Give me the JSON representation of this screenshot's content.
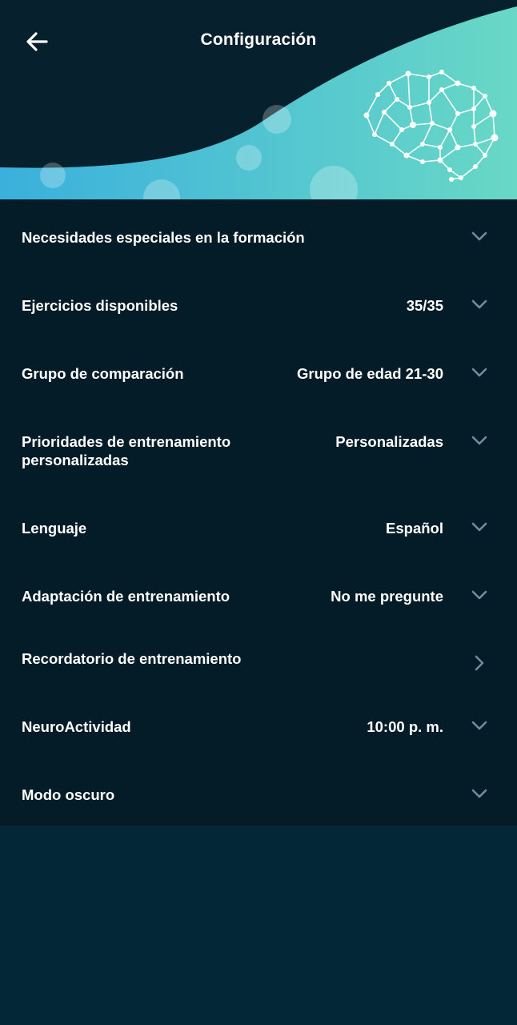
{
  "header": {
    "title": "Configuración",
    "back_icon": "arrow-left-icon",
    "illustration_icon": "brain-network-icon",
    "colors": {
      "background": "#06202d",
      "wave_start": "#3fb6d9",
      "wave_end": "#67d6c7"
    }
  },
  "settings": [
    {
      "label": "Necesidades especiales en la formación",
      "value": "",
      "icon": "chevron-down-icon"
    },
    {
      "label": "Ejercicios disponibles",
      "value": "35/35",
      "icon": "chevron-down-icon"
    },
    {
      "label": "Grupo de comparación",
      "value": "Grupo de edad 21-30",
      "icon": "chevron-down-icon"
    },
    {
      "label": "Prioridades de entrenamiento personalizadas",
      "value": "Personalizadas",
      "icon": "chevron-down-icon"
    },
    {
      "label": "Lenguaje",
      "value": "Español",
      "icon": "chevron-down-icon"
    },
    {
      "label": "Adaptación de entrenamiento",
      "value": "No me pregunte",
      "icon": "chevron-down-icon"
    },
    {
      "label": "Recordatorio de entrenamiento",
      "value": "",
      "icon": "chevron-right-icon"
    },
    {
      "label": "NeuroActividad",
      "value": "10:00 p. m.",
      "icon": "chevron-down-icon"
    },
    {
      "label": "Modo oscuro",
      "value": "",
      "icon": "chevron-down-icon"
    }
  ],
  "colors": {
    "list_background": "#031c28",
    "page_background": "#032737",
    "chevron": "#6f8ca0"
  }
}
